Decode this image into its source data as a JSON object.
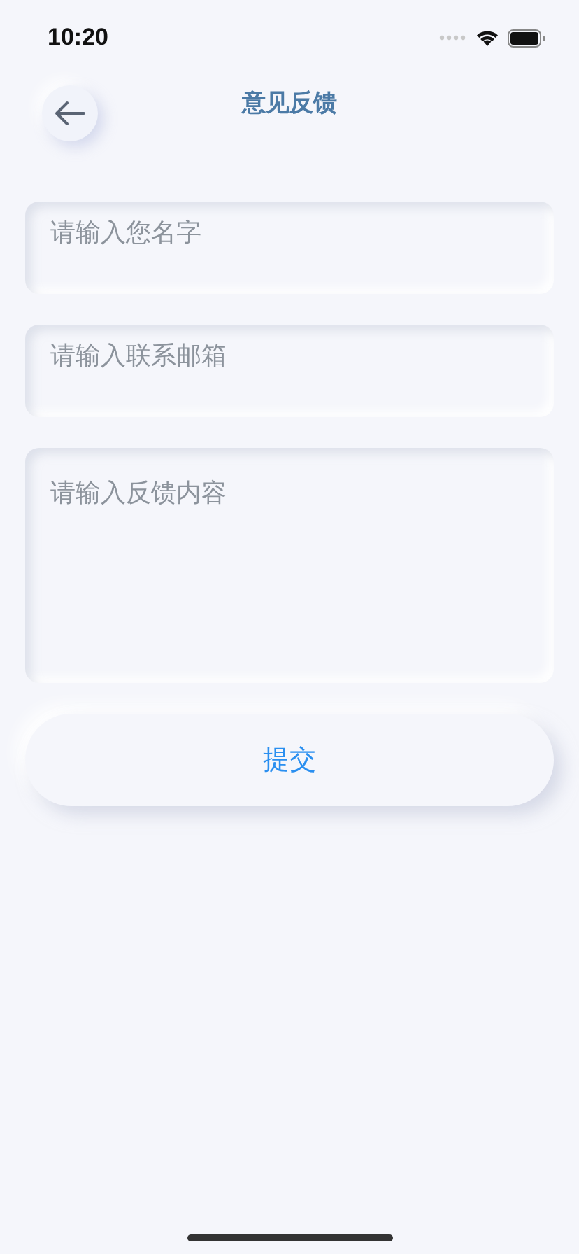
{
  "status_bar": {
    "time": "10:20"
  },
  "header": {
    "title": "意见反馈"
  },
  "fields": [
    {
      "kind": "input",
      "placeholder": "请输入您名字"
    },
    {
      "kind": "input",
      "placeholder": "请输入联系邮箱"
    },
    {
      "kind": "textarea",
      "placeholder": "请输入反馈内容"
    }
  ],
  "submit_button": {
    "label": "提交"
  }
}
